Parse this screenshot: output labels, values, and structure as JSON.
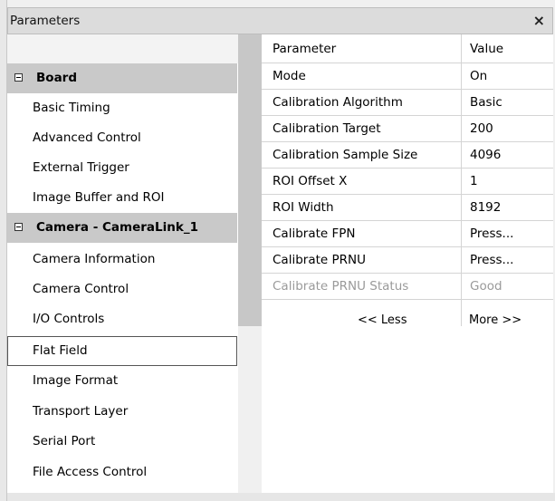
{
  "window": {
    "title": "Parameters",
    "close_glyph": "×"
  },
  "tree": {
    "items": [
      {
        "label": "Board",
        "kind": "group"
      },
      {
        "label": "Basic Timing",
        "kind": "item"
      },
      {
        "label": "Advanced Control",
        "kind": "item"
      },
      {
        "label": "External Trigger",
        "kind": "item"
      },
      {
        "label": "Image Buffer and ROI",
        "kind": "item"
      },
      {
        "label": "Camera - CameraLink_1",
        "kind": "group"
      },
      {
        "label": "Camera Information",
        "kind": "item"
      },
      {
        "label": "Camera Control",
        "kind": "item"
      },
      {
        "label": "I/O Controls",
        "kind": "item"
      },
      {
        "label": "Flat Field",
        "kind": "selected"
      },
      {
        "label": "Image Format",
        "kind": "item"
      },
      {
        "label": "Transport Layer",
        "kind": "item"
      },
      {
        "label": "Serial Port",
        "kind": "item"
      },
      {
        "label": "File Access Control",
        "kind": "item"
      }
    ]
  },
  "grid": {
    "headers": {
      "parameter": "Parameter",
      "value": "Value"
    },
    "rows": [
      {
        "name": "Mode",
        "value": "On"
      },
      {
        "name": "Calibration Algorithm",
        "value": "Basic"
      },
      {
        "name": "Calibration Target",
        "value": "200"
      },
      {
        "name": "Calibration Sample Size",
        "value": "4096"
      },
      {
        "name": "ROI Offset X",
        "value": "1"
      },
      {
        "name": "ROI Width",
        "value": "8192"
      },
      {
        "name": "Calibrate FPN",
        "value": "Press..."
      },
      {
        "name": "Calibrate PRNU",
        "value": "Press..."
      },
      {
        "name": "Calibrate PRNU Status",
        "value": "Good",
        "disabled": true
      }
    ],
    "less_label": "<< Less",
    "more_label": "More >>"
  }
}
